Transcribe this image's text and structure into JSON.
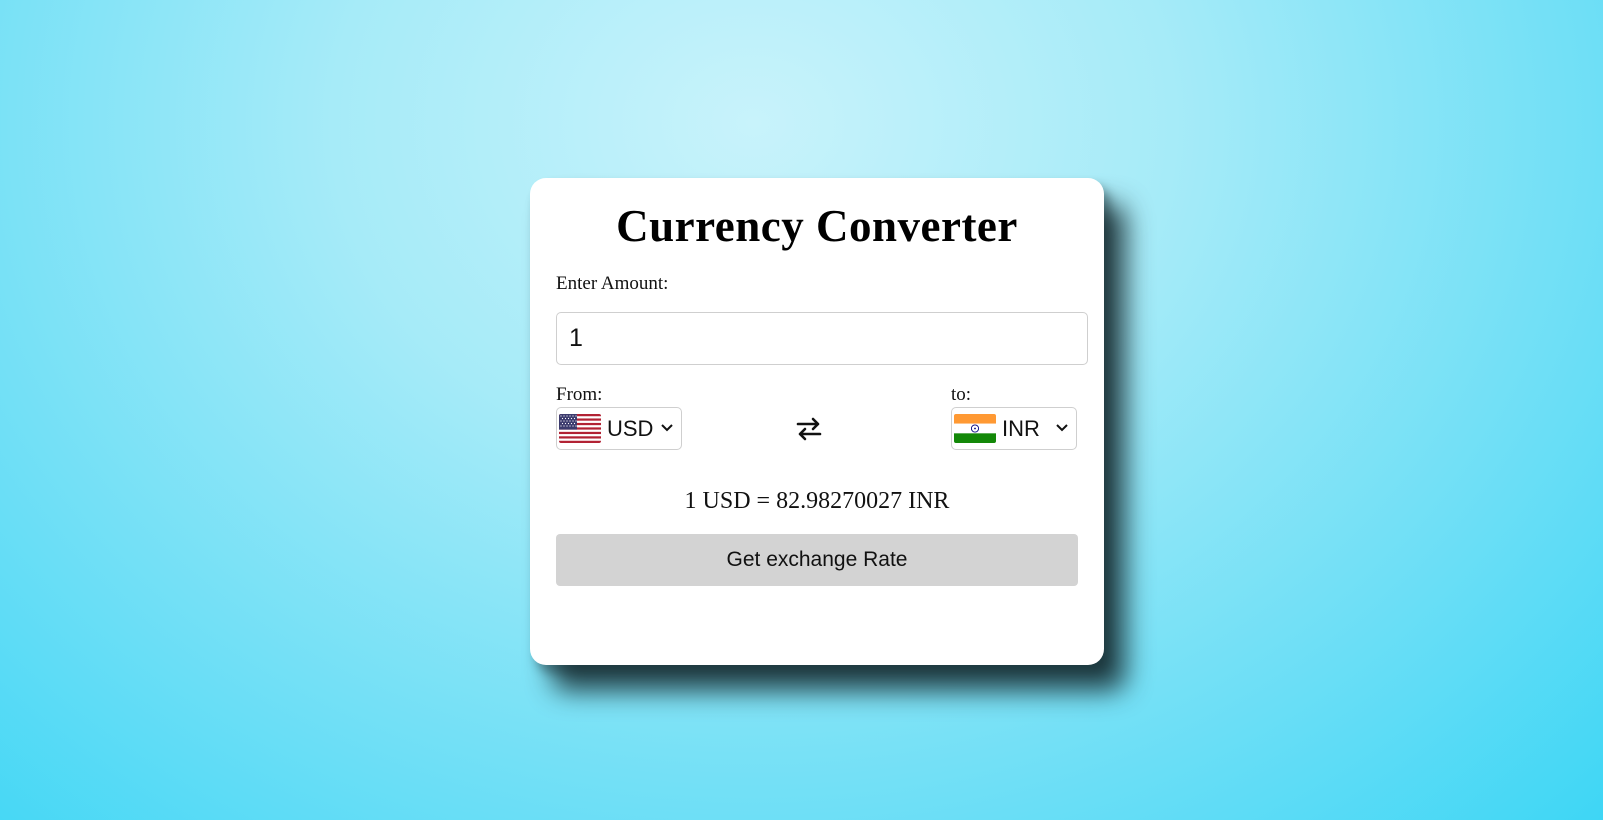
{
  "converter": {
    "title": "Currency Converter",
    "amount_label": "Enter Amount:",
    "amount_value": "1",
    "from_label": "From:",
    "to_label": "to:",
    "from_currency": {
      "code": "USD",
      "flag_icon": "us-flag-icon"
    },
    "to_currency": {
      "code": "INR",
      "flag_icon": "india-flag-icon"
    },
    "swap_icon": "swap-arrows-icon",
    "result_text": "1 USD = 82.98270027 INR",
    "button_label": "Get exchange Rate"
  },
  "colors": {
    "card_background": "#ffffff",
    "button_background": "#d3d3d3",
    "page_gradient_inner": "#c8f3fb",
    "page_gradient_outer": "#3ed6f5"
  }
}
